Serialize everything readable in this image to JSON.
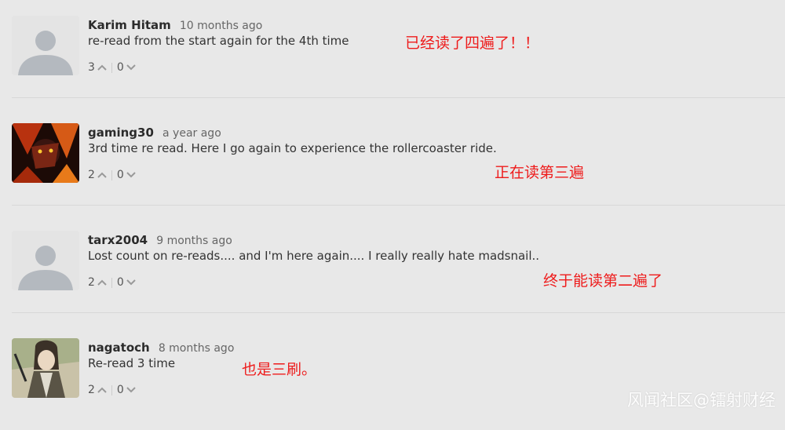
{
  "comments": [
    {
      "author": "Karim Hitam",
      "time": "10 months ago",
      "text": "re-read from the start again for the 4th time",
      "upvotes": "3",
      "downvotes": "0",
      "avatar": "default-avatar",
      "note": "已经读了四遍了！！"
    },
    {
      "author": "gaming30",
      "time": "a year ago",
      "text": "3rd time re read. Here I go again to experience the rollercoaster ride.",
      "upvotes": "2",
      "downvotes": "0",
      "avatar": "anime-avatar-red",
      "note": "正在读第三遍"
    },
    {
      "author": "tarx2004",
      "time": "9 months ago",
      "text": "Lost count on re-reads.... and I'm here again.... I really really hate madsnail..",
      "upvotes": "2",
      "downvotes": "0",
      "avatar": "default-avatar",
      "note": "终于能读第二遍了"
    },
    {
      "author": "nagatoch",
      "time": "8 months ago",
      "text": "Re-read 3 time",
      "upvotes": "2",
      "downvotes": "0",
      "avatar": "anime-avatar-green",
      "note": "也是三刷。"
    }
  ],
  "watermark": "风闻社区@镭射财经",
  "colors": {
    "background": "#e8e8e8",
    "note": "#ee1b1b",
    "divider": "#d8d8d8"
  }
}
